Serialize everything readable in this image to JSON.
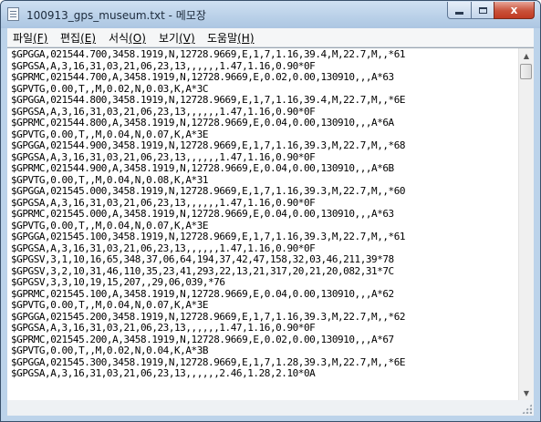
{
  "window": {
    "title": "100913_gps_museum.txt - 메모장",
    "controls": {
      "minimize": "",
      "maximize": "",
      "close": "x"
    }
  },
  "menu": [
    {
      "label": "파일",
      "accel": "(F)"
    },
    {
      "label": "편집",
      "accel": "(E)"
    },
    {
      "label": "서식",
      "accel": "(O)"
    },
    {
      "label": "보기",
      "accel": "(V)"
    },
    {
      "label": "도움말",
      "accel": "(H)"
    }
  ],
  "content": {
    "lines": [
      "$GPGGA,021544.700,3458.1919,N,12728.9669,E,1,7,1.16,39.4,M,22.7,M,,*61",
      "$GPGSA,A,3,16,31,03,21,06,23,13,,,,,,1.47,1.16,0.90*0F",
      "$GPRMC,021544.700,A,3458.1919,N,12728.9669,E,0.02,0.00,130910,,,A*63",
      "$GPVTG,0.00,T,,M,0.02,N,0.03,K,A*3C",
      "$GPGGA,021544.800,3458.1919,N,12728.9669,E,1,7,1.16,39.4,M,22.7,M,,*6E",
      "$GPGSA,A,3,16,31,03,21,06,23,13,,,,,,1.47,1.16,0.90*0F",
      "$GPRMC,021544.800,A,3458.1919,N,12728.9669,E,0.04,0.00,130910,,,A*6A",
      "$GPVTG,0.00,T,,M,0.04,N,0.07,K,A*3E",
      "$GPGGA,021544.900,3458.1919,N,12728.9669,E,1,7,1.16,39.3,M,22.7,M,,*68",
      "$GPGSA,A,3,16,31,03,21,06,23,13,,,,,,1.47,1.16,0.90*0F",
      "$GPRMC,021544.900,A,3458.1919,N,12728.9669,E,0.04,0.00,130910,,,A*6B",
      "$GPVTG,0.00,T,,M,0.04,N,0.08,K,A*31",
      "$GPGGA,021545.000,3458.1919,N,12728.9669,E,1,7,1.16,39.3,M,22.7,M,,*60",
      "$GPGSA,A,3,16,31,03,21,06,23,13,,,,,,1.47,1.16,0.90*0F",
      "$GPRMC,021545.000,A,3458.1919,N,12728.9669,E,0.04,0.00,130910,,,A*63",
      "$GPVTG,0.00,T,,M,0.04,N,0.07,K,A*3E",
      "$GPGGA,021545.100,3458.1919,N,12728.9669,E,1,7,1.16,39.3,M,22.7,M,,*61",
      "$GPGSA,A,3,16,31,03,21,06,23,13,,,,,,1.47,1.16,0.90*0F",
      "$GPGSV,3,1,10,16,65,348,37,06,64,194,37,42,47,158,32,03,46,211,39*78",
      "$GPGSV,3,2,10,31,46,110,35,23,41,293,22,13,21,317,20,21,20,082,31*7C",
      "$GPGSV,3,3,10,19,15,207,,29,06,039,*76",
      "$GPRMC,021545.100,A,3458.1919,N,12728.9669,E,0.04,0.00,130910,,,A*62",
      "$GPVTG,0.00,T,,M,0.04,N,0.07,K,A*3E",
      "$GPGGA,021545.200,3458.1919,N,12728.9669,E,1,7,1.16,39.3,M,22.7,M,,*62",
      "$GPGSA,A,3,16,31,03,21,06,23,13,,,,,,1.47,1.16,0.90*0F",
      "$GPRMC,021545.200,A,3458.1919,N,12728.9669,E,0.02,0.00,130910,,,A*67",
      "$GPVTG,0.00,T,,M,0.02,N,0.04,K,A*3B",
      "$GPGGA,021545.300,3458.1919,N,12728.9669,E,1,7,1.28,39.3,M,22.7,M,,*6E",
      "$GPGSA,A,3,16,31,03,21,06,23,13,,,,,,2.46,1.28,2.10*0A"
    ]
  },
  "scrollbar": {
    "up": "▲",
    "down": "▼"
  },
  "icons": {
    "app": "notepad-icon",
    "minimize": "minimize-icon",
    "maximize": "maximize-icon",
    "close": "close-icon",
    "grip": "resize-grip-icon"
  }
}
